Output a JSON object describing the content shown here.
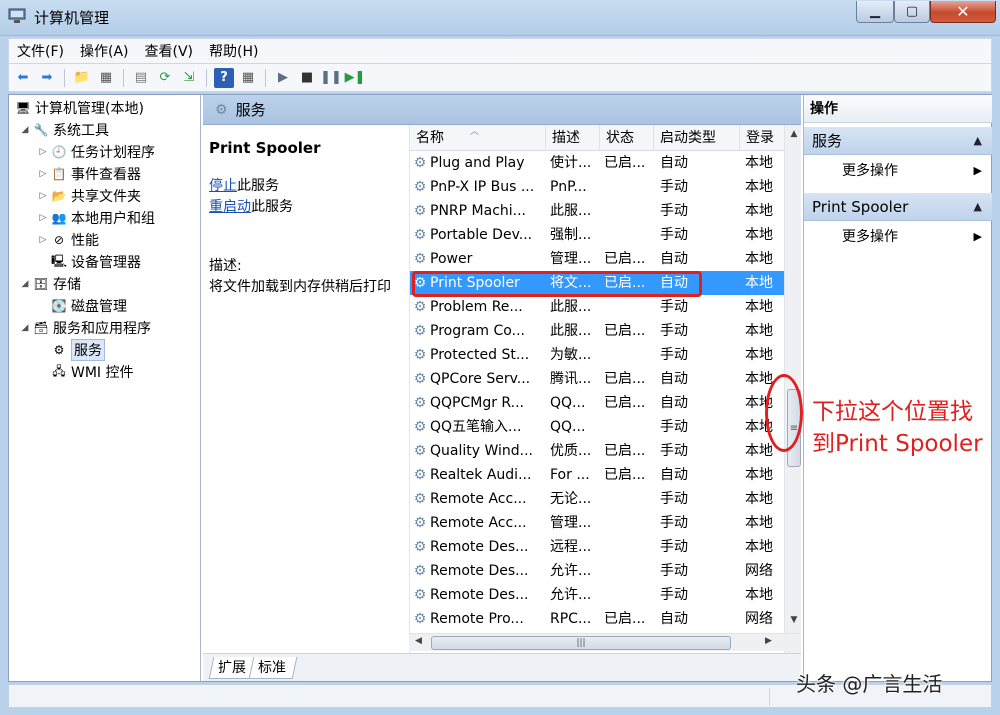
{
  "window": {
    "title": "计算机管理",
    "minimize_icon": "minimize-icon",
    "maximize_icon": "maximize-icon",
    "close_icon": "close-icon"
  },
  "menu": [
    "文件(F)",
    "操作(A)",
    "查看(V)",
    "帮助(H)"
  ],
  "toolbar_icons": [
    "back-icon",
    "forward-icon",
    "up-icon",
    "show-tree-icon",
    "properties-icon",
    "refresh-icon",
    "export-icon",
    "help-icon",
    "view-icon",
    "start-icon",
    "stop-icon",
    "pause-icon",
    "restart-icon"
  ],
  "tree": {
    "root": "计算机管理(本地)",
    "items": [
      {
        "label": "系统工具",
        "icon": "tools-icon"
      },
      {
        "label": "任务计划程序",
        "icon": "clock-icon"
      },
      {
        "label": "事件查看器",
        "icon": "event-viewer-icon"
      },
      {
        "label": "共享文件夹",
        "icon": "shared-folder-icon"
      },
      {
        "label": "本地用户和组",
        "icon": "users-icon"
      },
      {
        "label": "性能",
        "icon": "performance-icon"
      },
      {
        "label": "设备管理器",
        "icon": "device-manager-icon"
      },
      {
        "label": "存储",
        "icon": "storage-icon"
      },
      {
        "label": "磁盘管理",
        "icon": "disk-icon"
      },
      {
        "label": "服务和应用程序",
        "icon": "services-apps-icon"
      },
      {
        "label": "服务",
        "icon": "services-icon"
      },
      {
        "label": "WMI 控件",
        "icon": "wmi-icon"
      }
    ]
  },
  "center": {
    "header": "服务",
    "selected_service": "Print Spooler",
    "stop_link": "停止",
    "stop_suffix": "此服务",
    "restart_link": "重启动",
    "restart_suffix": "此服务",
    "desc_label": "描述:",
    "desc_text": "将文件加载到内存供稍后打印"
  },
  "list": {
    "columns": [
      "名称",
      "描述",
      "状态",
      "启动类型",
      "登录"
    ],
    "rows": [
      {
        "name": "Plug and Play",
        "desc": "使计...",
        "status": "已启...",
        "startup": "自动",
        "logon": "本地"
      },
      {
        "name": "PnP-X IP Bus ...",
        "desc": "PnP...",
        "status": "",
        "startup": "手动",
        "logon": "本地"
      },
      {
        "name": "PNRP Machi...",
        "desc": "此服...",
        "status": "",
        "startup": "手动",
        "logon": "本地"
      },
      {
        "name": "Portable Dev...",
        "desc": "强制...",
        "status": "",
        "startup": "手动",
        "logon": "本地"
      },
      {
        "name": "Power",
        "desc": "管理...",
        "status": "已启...",
        "startup": "自动",
        "logon": "本地"
      },
      {
        "name": "Print Spooler",
        "desc": "将文...",
        "status": "已启...",
        "startup": "自动",
        "logon": "本地"
      },
      {
        "name": "Problem Re...",
        "desc": "此服...",
        "status": "",
        "startup": "手动",
        "logon": "本地"
      },
      {
        "name": "Program Co...",
        "desc": "此服...",
        "status": "已启...",
        "startup": "手动",
        "logon": "本地"
      },
      {
        "name": "Protected St...",
        "desc": "为敏...",
        "status": "",
        "startup": "手动",
        "logon": "本地"
      },
      {
        "name": "QPCore Serv...",
        "desc": "腾讯...",
        "status": "已启...",
        "startup": "自动",
        "logon": "本地"
      },
      {
        "name": "QQPCMgr R...",
        "desc": "QQ...",
        "status": "已启...",
        "startup": "自动",
        "logon": "本地"
      },
      {
        "name": "QQ五笔输入...",
        "desc": "QQ...",
        "status": "",
        "startup": "手动",
        "logon": "本地"
      },
      {
        "name": "Quality Wind...",
        "desc": "优质...",
        "status": "已启...",
        "startup": "手动",
        "logon": "本地"
      },
      {
        "name": "Realtek Audi...",
        "desc": "For ...",
        "status": "已启...",
        "startup": "自动",
        "logon": "本地"
      },
      {
        "name": "Remote Acc...",
        "desc": "无论...",
        "status": "",
        "startup": "手动",
        "logon": "本地"
      },
      {
        "name": "Remote Acc...",
        "desc": "管理...",
        "status": "",
        "startup": "手动",
        "logon": "本地"
      },
      {
        "name": "Remote Des...",
        "desc": "远程...",
        "status": "",
        "startup": "手动",
        "logon": "本地"
      },
      {
        "name": "Remote Des...",
        "desc": "允许...",
        "status": "",
        "startup": "手动",
        "logon": "网络"
      },
      {
        "name": "Remote Des...",
        "desc": "允许...",
        "status": "",
        "startup": "手动",
        "logon": "本地"
      },
      {
        "name": "Remote Pro...",
        "desc": "RPC...",
        "status": "已启...",
        "startup": "自动",
        "logon": "网络"
      }
    ],
    "selected_index": 5
  },
  "tabs": [
    "扩展",
    "标准"
  ],
  "actions": {
    "header": "操作",
    "groups": [
      {
        "title": "服务",
        "item": "更多操作"
      },
      {
        "title": "Print Spooler",
        "item": "更多操作"
      }
    ]
  },
  "annotation": {
    "line1": "下拉这个位置找",
    "line2": "到Print Spooler"
  },
  "watermark": "头条 @广言生活",
  "colors": {
    "highlight": "#3399ff",
    "annotation": "#e02020"
  }
}
